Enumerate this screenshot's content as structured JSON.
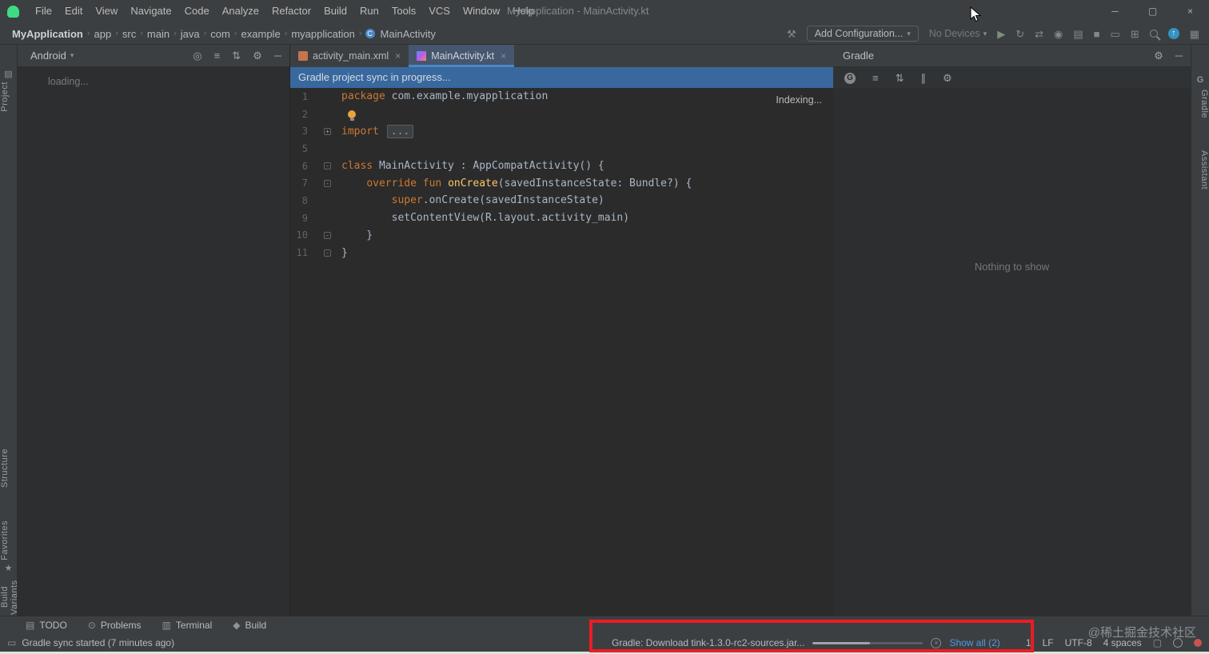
{
  "window": {
    "title": "My Application - MainActivity.kt",
    "controls": {
      "minimize": "─",
      "maximize": "▢",
      "close": "×"
    }
  },
  "menu": {
    "items": [
      "File",
      "Edit",
      "View",
      "Navigate",
      "Code",
      "Analyze",
      "Refactor",
      "Build",
      "Run",
      "Tools",
      "VCS",
      "Window",
      "Help"
    ]
  },
  "breadcrumb": {
    "items": [
      "MyApplication",
      "app",
      "src",
      "main",
      "java",
      "com",
      "example",
      "myapplication",
      "MainActivity"
    ],
    "separator": "›",
    "class_icon": "C"
  },
  "nav": {
    "hammer_icon": "⚒",
    "add_configuration": "Add Configuration...",
    "no_devices": "No Devices",
    "dropdown_caret": "▾",
    "icons": [
      {
        "name": "run-icon",
        "glyph": "▶",
        "cls": "run"
      },
      {
        "name": "apply-changes-icon",
        "glyph": "↻"
      },
      {
        "name": "apply-code-changes-icon",
        "glyph": "⇄"
      },
      {
        "name": "debug-icon",
        "glyph": "◉"
      },
      {
        "name": "profiler-icon",
        "glyph": "▤"
      },
      {
        "name": "stop-icon",
        "glyph": "■"
      },
      {
        "name": "device-manager-icon",
        "glyph": "▭"
      },
      {
        "name": "layout-inspector-icon",
        "glyph": "⊞"
      },
      {
        "name": "search-icon",
        "css": "search"
      },
      {
        "name": "updates-icon",
        "css": "update",
        "glyph": "↑"
      },
      {
        "name": "grid-icon",
        "glyph": "▦"
      }
    ]
  },
  "left_strip": {
    "project_icon": "▤",
    "project": "Project",
    "structure": "Structure",
    "favorites": "Favorites",
    "star_icon": "★",
    "build_variants": "Build Variants"
  },
  "right_strip": {
    "gradle_icon": "G",
    "gradle": "Gradle",
    "assistant": "Assistant"
  },
  "project_panel": {
    "selector": "Android",
    "caret": "▾",
    "icons": [
      {
        "name": "locate-file-icon",
        "glyph": "◎"
      },
      {
        "name": "expand-all-icon",
        "glyph": "≡"
      },
      {
        "name": "collapse-all-icon",
        "glyph": "⇅"
      },
      {
        "name": "settings-icon",
        "glyph": "⚙"
      },
      {
        "name": "hide-panel-icon",
        "glyph": "─"
      }
    ],
    "loading": "loading..."
  },
  "editor": {
    "tabs": [
      {
        "label": "activity_main.xml",
        "icon": "layout",
        "close": "×",
        "active": false
      },
      {
        "label": "MainActivity.kt",
        "icon": "kotlin",
        "close": "×",
        "active": true
      }
    ],
    "sync_banner": "Gradle project sync in progress...",
    "indexing": "Indexing...",
    "lines": [
      {
        "num": "1",
        "segments": [
          {
            "t": "package ",
            "c": "kw"
          },
          {
            "t": "com.example.myapplication",
            "c": "pl"
          }
        ]
      },
      {
        "num": "2",
        "bulb": true,
        "segments": []
      },
      {
        "num": "3",
        "fold": "+",
        "segments": [
          {
            "t": "import ",
            "c": "kw"
          },
          {
            "t": "...",
            "c": "foldbox"
          }
        ]
      },
      {
        "num": "5",
        "segments": []
      },
      {
        "num": "6",
        "fold": "-",
        "segments": [
          {
            "t": "class ",
            "c": "kw"
          },
          {
            "t": "MainActivity : AppCompatActivity() {",
            "c": "pl"
          }
        ]
      },
      {
        "num": "7",
        "fold": "-",
        "segments": [
          {
            "t": "    ",
            "c": "pl"
          },
          {
            "t": "override fun ",
            "c": "kw"
          },
          {
            "t": "onCreate",
            "c": "fn"
          },
          {
            "t": "(savedInstanceState: Bundle?) {",
            "c": "pl"
          }
        ]
      },
      {
        "num": "8",
        "segments": [
          {
            "t": "        ",
            "c": "pl"
          },
          {
            "t": "super",
            "c": "kw"
          },
          {
            "t": ".onCreate(savedInstanceState)",
            "c": "pl"
          }
        ]
      },
      {
        "num": "9",
        "segments": [
          {
            "t": "        setContentView(R.layout.activity_main)",
            "c": "pl"
          }
        ]
      },
      {
        "num": "10",
        "fold": "-",
        "segments": [
          {
            "t": "    }",
            "c": "pl"
          }
        ]
      },
      {
        "num": "11",
        "fold": "-",
        "segments": [
          {
            "t": "}",
            "c": "pl"
          }
        ]
      }
    ]
  },
  "gradle_panel": {
    "title": "Gradle",
    "header_icons": [
      {
        "name": "settings-icon",
        "glyph": "⚙"
      },
      {
        "name": "hide-panel-icon",
        "glyph": "─"
      }
    ],
    "toolbar_icons": [
      {
        "name": "gradle-elephant-icon",
        "badge": "G"
      },
      {
        "name": "expand-all-icon",
        "glyph": "≡"
      },
      {
        "name": "collapse-all-icon",
        "glyph": "⇅"
      },
      {
        "name": "toggle-offline-icon",
        "glyph": "∥"
      },
      {
        "name": "gradle-settings-icon",
        "glyph": "⚙"
      }
    ],
    "empty": "Nothing to show"
  },
  "bottom_tools": [
    {
      "name": "todo",
      "icon": "▤",
      "label": "TODO"
    },
    {
      "name": "problems",
      "icon": "⊙",
      "label": "Problems"
    },
    {
      "name": "terminal",
      "icon": "▥",
      "label": "Terminal"
    },
    {
      "name": "build",
      "icon": "◆",
      "label": "Build"
    }
  ],
  "status_bar": {
    "left_icon": "▭",
    "left_text": "Gradle sync started (7 minutes ago)",
    "task_text": "Gradle: Download tink-1.3.0-rc2-sources.jar...",
    "progress_percent": 52,
    "dismiss_icon": "×",
    "show_all": "Show all (2)",
    "caret": "1",
    "line_ending": "LF",
    "encoding": "UTF-8",
    "indent": "4 spaces"
  },
  "watermark": "@稀土掘金技术社区",
  "colors": {
    "panel_bg": "#3c3f41",
    "editor_bg": "#2b2b2b",
    "banner_blue": "#38689e",
    "tab_underline_blue": "#4a88c7",
    "link_blue": "#5598e0",
    "keyword_orange": "#cc7832",
    "function_yellow": "#ffc66b",
    "annotation_red": "#ec1c24",
    "android_green": "#3ddc84"
  }
}
